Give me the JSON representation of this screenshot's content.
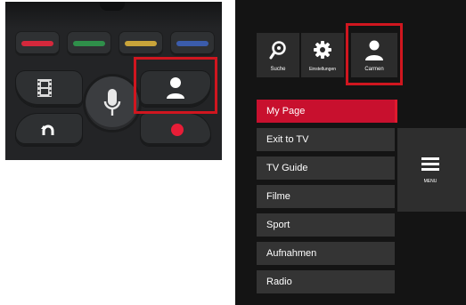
{
  "remote": {
    "color_buttons": [
      {
        "name": "red",
        "color": "#d4283c"
      },
      {
        "name": "green",
        "color": "#2f8f4a"
      },
      {
        "name": "yellow",
        "color": "#c9a43a"
      },
      {
        "name": "blue",
        "color": "#3b5cab"
      }
    ],
    "icons": {
      "film": "film-icon",
      "mic": "microphone-icon",
      "person": "person-icon",
      "back": "back-arrow-icon",
      "record": "record-icon"
    },
    "highlight_color": "#d0161f"
  },
  "tv": {
    "top_icons": [
      {
        "label": "Suche",
        "icon": "search-icon"
      },
      {
        "label": "Einstellungen",
        "icon": "gear-icon"
      },
      {
        "label": "Carmen",
        "icon": "person-icon"
      }
    ],
    "menu_items": [
      {
        "label": "My Page",
        "active": true
      },
      {
        "label": "Exit to TV"
      },
      {
        "label": "TV Guide"
      },
      {
        "label": "Filme"
      },
      {
        "label": "Sport"
      },
      {
        "label": "Aufnahmen"
      },
      {
        "label": "Radio"
      }
    ],
    "menu_button": {
      "label": "MENU",
      "icon": "hamburger-icon"
    },
    "accent_color": "#c8102e"
  }
}
